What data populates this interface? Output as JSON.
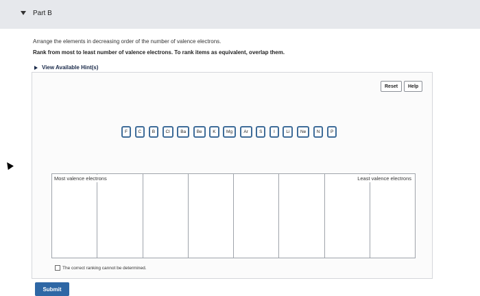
{
  "header": {
    "title": "Part B"
  },
  "instructions": {
    "line1": "Arrange the elements in decreasing order of the number of valence electrons.",
    "line2": "Rank from most to least number of valence electrons. To rank items as equivalent, overlap them."
  },
  "hints": {
    "label": "View Available Hint(s)"
  },
  "controls": {
    "reset": "Reset",
    "help": "Help"
  },
  "tiles": [
    "F",
    "C",
    "B",
    "Cl",
    "Ba",
    "Be",
    "K",
    "Mg",
    "Ar",
    "S",
    "I",
    "Li",
    "Ne",
    "N",
    "P"
  ],
  "ranking": {
    "left_label": "Most valence electrons",
    "right_label": "Least valence electrons",
    "slot_count": 8
  },
  "cannot_determine": "The correct ranking cannot be determined.",
  "submit": "Submit",
  "colors": {
    "accent": "#2e67a5",
    "tile_border": "#3d6b98",
    "header_bg": "#e6e8ec"
  }
}
